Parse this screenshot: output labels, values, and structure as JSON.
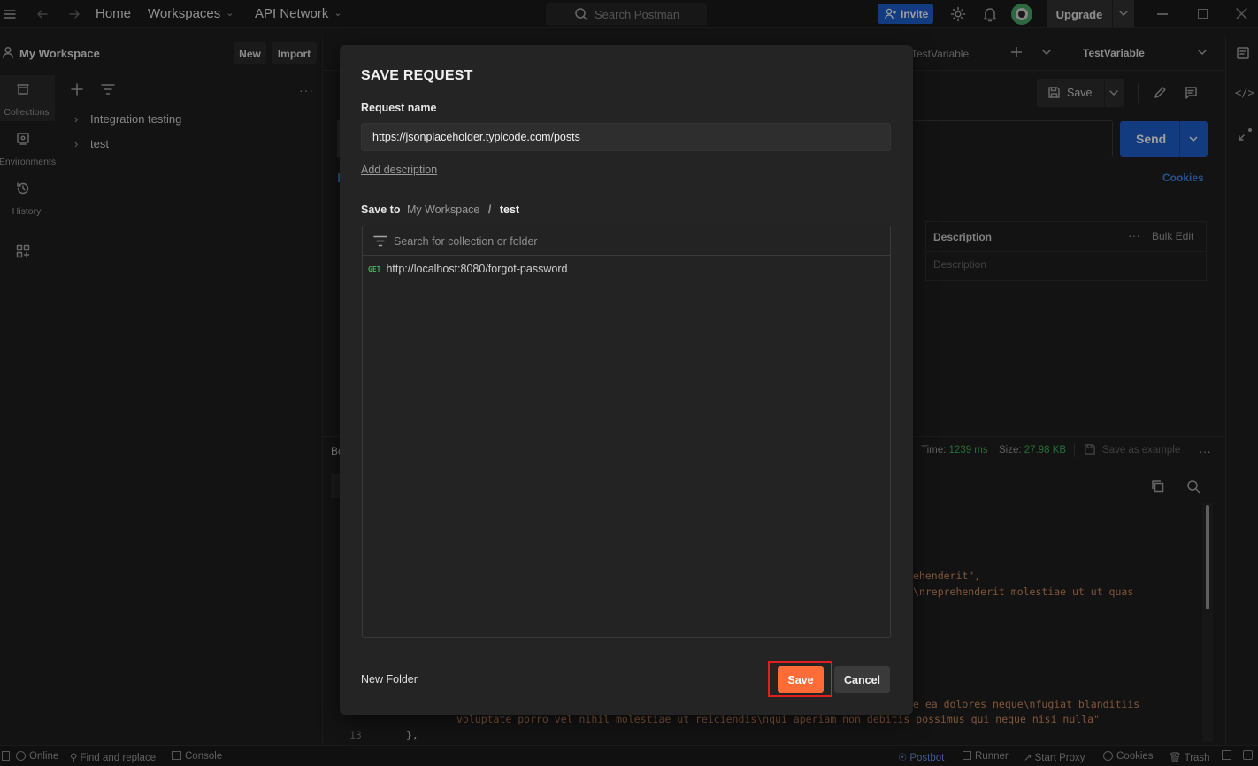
{
  "header": {
    "nav": {
      "home": "Home",
      "workspaces": "Workspaces",
      "api_network": "API Network"
    },
    "search_placeholder": "Search Postman",
    "invite_label": "Invite",
    "upgrade_label": "Upgrade"
  },
  "rail": {
    "collections": "Collections",
    "environments": "Environments",
    "history": "History"
  },
  "sidebar": {
    "workspace_name": "My Workspace",
    "new_label": "New",
    "import_label": "Import",
    "collections": [
      "Integration testing",
      "test"
    ]
  },
  "main": {
    "tab_env_partial": "TestVariable",
    "env_selector": "TestVariable",
    "save_label": "Save",
    "send_label": "Send",
    "cookies_label": "Cookies",
    "params_description_header": "Description",
    "bulk_edit_label": "Bulk Edit",
    "description_placeholder": "Description",
    "response": {
      "time_label": "Time:",
      "time_value": "1239 ms",
      "size_label": "Size:",
      "size_value": "27.98 KB",
      "save_example_label": "Save as example",
      "code_lines": [
        "ehenderit\",",
        "\\nreprehenderit molestiae ut ut quas",
        "e ea dolores neque\\nfugiat blanditiis",
        "voluptate porro vel nihil molestiae ut reiciendis\\nqui aperiam non debitis possimus qui neque nisi nulla\"",
        "},"
      ],
      "line_number": "13",
      "tab_partial": "Bo"
    }
  },
  "modal": {
    "title": "SAVE REQUEST",
    "request_name_label": "Request name",
    "request_name_value": "https://jsonplaceholder.typicode.com/posts",
    "add_description": "Add description",
    "save_to_label": "Save to",
    "save_to_workspace": "My Workspace",
    "save_to_separator": "/",
    "save_to_destination": "test",
    "browser_search_placeholder": "Search for collection or folder",
    "requests": [
      {
        "method": "GET",
        "url": "http://localhost:8080/forgot-password"
      }
    ],
    "new_folder_label": "New Folder",
    "save_label": "Save",
    "cancel_label": "Cancel"
  },
  "statusbar": {
    "online": "Online",
    "find_replace": "Find and replace",
    "console": "Console",
    "postbot": "Postbot",
    "runner": "Runner",
    "start_proxy": "Start Proxy",
    "cookies": "Cookies",
    "trash": "Trash"
  },
  "colors": {
    "accent_orange": "#ff6c37",
    "primary_blue": "#1f5fcf",
    "highlight_red": "#e02020",
    "get_green": "#3fae5a"
  }
}
